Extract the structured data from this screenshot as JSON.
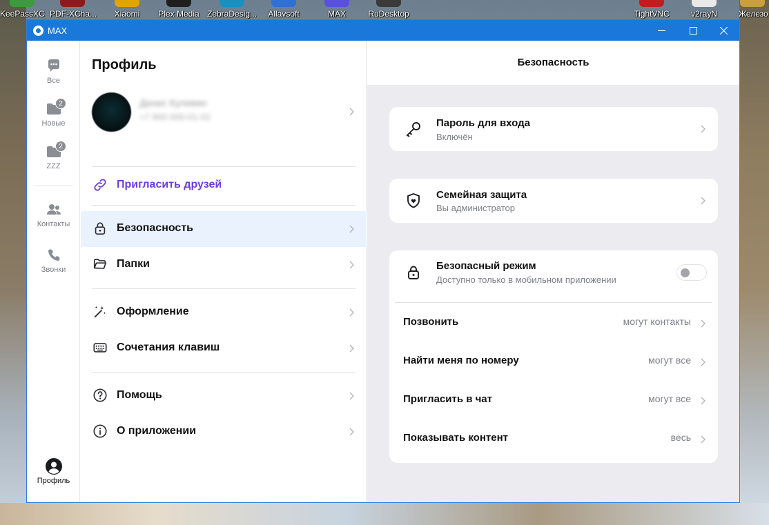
{
  "desktop": {
    "icons": [
      {
        "label": "KeePassXC"
      },
      {
        "label": "PDF-XCha..."
      },
      {
        "label": "Xiaomi"
      },
      {
        "label": "Plex Media"
      },
      {
        "label": "ZebraDesig..."
      },
      {
        "label": "Allavsoft"
      },
      {
        "label": "MAX"
      },
      {
        "label": "RuDesktop"
      },
      {
        "label": "TightVNC"
      },
      {
        "label": "v2rayN"
      },
      {
        "label": "Железо"
      }
    ]
  },
  "window": {
    "title": "MAX",
    "icon": "max-app-icon",
    "controls": [
      "minimize-icon",
      "maximize-icon",
      "close-icon"
    ]
  },
  "rail": {
    "items": [
      {
        "label": "Все",
        "icon": "chat-bubble-icon"
      },
      {
        "label": "Новые",
        "icon": "folder-icon",
        "badge": "2"
      },
      {
        "label": "ZZZ",
        "icon": "folder-icon",
        "badge": "2"
      },
      {
        "label": "Контакты",
        "icon": "contacts-icon"
      },
      {
        "label": "Звонки",
        "icon": "phone-icon"
      }
    ],
    "profile": {
      "label": "Профиль",
      "icon": "profile-icon"
    }
  },
  "profile_panel": {
    "title": "Профиль",
    "user": {
      "name": "Денис Кулевин",
      "phone": "+7 900 000-01-02"
    },
    "invite": {
      "label": "Пригласить друзей",
      "icon": "link-icon"
    },
    "menu": [
      {
        "label": "Безопасность",
        "icon": "lock-icon",
        "active": true
      },
      {
        "label": "Папки",
        "icon": "folder-open-icon"
      },
      {
        "label": "Оформление",
        "icon": "magic-wand-icon"
      },
      {
        "label": "Сочетания клавиш",
        "icon": "keyboard-icon"
      },
      {
        "label": "Помощь",
        "icon": "help-icon"
      },
      {
        "label": "О приложении",
        "icon": "info-icon"
      }
    ]
  },
  "security": {
    "title": "Безопасность",
    "password": {
      "title": "Пароль для входа",
      "subtitle": "Включён",
      "icon": "key-icon"
    },
    "family": {
      "title": "Семейная защита",
      "subtitle": "Вы администратор",
      "icon": "shield-heart-icon"
    },
    "safe_mode": {
      "title": "Безопасный режим",
      "subtitle": "Доступно только в мобильном приложении",
      "icon": "lock-icon",
      "enabled": false
    },
    "privacy": [
      {
        "label": "Позвонить",
        "value": "могут контакты"
      },
      {
        "label": "Найти меня по номеру",
        "value": "могут все"
      },
      {
        "label": "Пригласить в чат",
        "value": "могут все"
      },
      {
        "label": "Показывать контент",
        "value": "весь"
      }
    ]
  },
  "colors": {
    "accent": "#1a78db",
    "invite": "#6b3de0",
    "active_row": "#e9f2fd",
    "panel_bg": "#ececf0"
  }
}
